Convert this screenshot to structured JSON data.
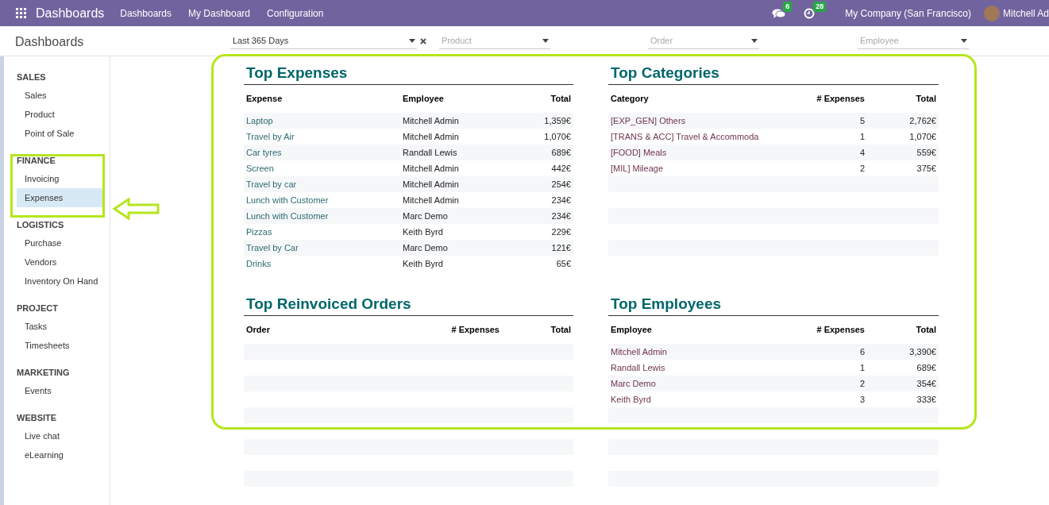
{
  "topbar": {
    "app_title": "Dashboards",
    "menu": [
      "Dashboards",
      "My Dashboard",
      "Configuration"
    ],
    "messages_badge": "6",
    "activities_badge": "28",
    "company": "My Company (San Francisco)",
    "user": "Mitchell Ad"
  },
  "control_panel": {
    "title": "Dashboards",
    "filters": [
      {
        "kind": "value",
        "text": "Last 365 Days"
      },
      {
        "kind": "placeholder",
        "text": "Product"
      },
      {
        "kind": "placeholder",
        "text": "Order"
      },
      {
        "kind": "placeholder",
        "text": "Employee"
      }
    ]
  },
  "sidebar": [
    {
      "heading": "SALES",
      "items": [
        {
          "label": "Sales",
          "selected": false
        },
        {
          "label": "Product",
          "selected": false
        },
        {
          "label": "Point of Sale",
          "selected": false
        }
      ]
    },
    {
      "heading": "FINANCE",
      "items": [
        {
          "label": "Invoicing",
          "selected": false
        },
        {
          "label": "Expenses",
          "selected": true
        }
      ]
    },
    {
      "heading": "LOGISTICS",
      "items": [
        {
          "label": "Purchase",
          "selected": false
        },
        {
          "label": "Vendors",
          "selected": false
        },
        {
          "label": "Inventory On Hand",
          "selected": false
        }
      ]
    },
    {
      "heading": "PROJECT",
      "items": [
        {
          "label": "Tasks",
          "selected": false
        },
        {
          "label": "Timesheets",
          "selected": false
        }
      ]
    },
    {
      "heading": "MARKETING",
      "items": [
        {
          "label": "Events",
          "selected": false
        }
      ]
    },
    {
      "heading": "WEBSITE",
      "items": [
        {
          "label": "Live chat",
          "selected": false
        },
        {
          "label": "eLearning",
          "selected": false
        }
      ]
    }
  ],
  "panels": [
    {
      "title": "Top Expenses",
      "kind": "expenses",
      "columns": [
        "Expense",
        "Employee",
        "Total"
      ],
      "rows": [
        [
          "Laptop",
          "Mitchell Admin",
          "1,359€"
        ],
        [
          "Travel by Air",
          "Mitchell Admin",
          "1,070€"
        ],
        [
          "Car tyres",
          "Randall Lewis",
          "689€"
        ],
        [
          "Screen",
          "Mitchell Admin",
          "442€"
        ],
        [
          "Travel by car",
          "Mitchell Admin",
          "254€"
        ],
        [
          "Lunch with Customer",
          "Mitchell Admin",
          "234€"
        ],
        [
          "Lunch with Customer",
          "Marc Demo",
          "234€"
        ],
        [
          "Pizzas",
          "Keith Byrd",
          "229€"
        ],
        [
          "Travel by Car",
          "Marc Demo",
          "121€"
        ],
        [
          "Drinks",
          "Keith Byrd",
          "65€"
        ]
      ]
    },
    {
      "title": "Top Categories",
      "kind": "summary",
      "columns": [
        "Category",
        "# Expenses",
        "Total"
      ],
      "rows": [
        [
          "[EXP_GEN] Others",
          "5",
          "2,762€"
        ],
        [
          "[TRANS & ACC] Travel & Accommoda",
          "1",
          "1,070€"
        ],
        [
          "[FOOD] Meals",
          "4",
          "559€"
        ],
        [
          "[MIL] Mileage",
          "2",
          "375€"
        ]
      ]
    },
    {
      "title": "Top Reinvoiced Orders",
      "columns": [
        "Order",
        "# Expenses",
        "Total"
      ]
    },
    {
      "title": "Top Employees",
      "kind": "summary",
      "columns": [
        "Employee",
        "# Expenses",
        "Total"
      ],
      "rows": [
        [
          "Mitchell Admin",
          "6",
          "3,390€"
        ],
        [
          "Randall Lewis",
          "1",
          "689€"
        ],
        [
          "Marc Demo",
          "2",
          "354€"
        ],
        [
          "Keith Byrd",
          "3",
          "333€"
        ]
      ]
    }
  ]
}
